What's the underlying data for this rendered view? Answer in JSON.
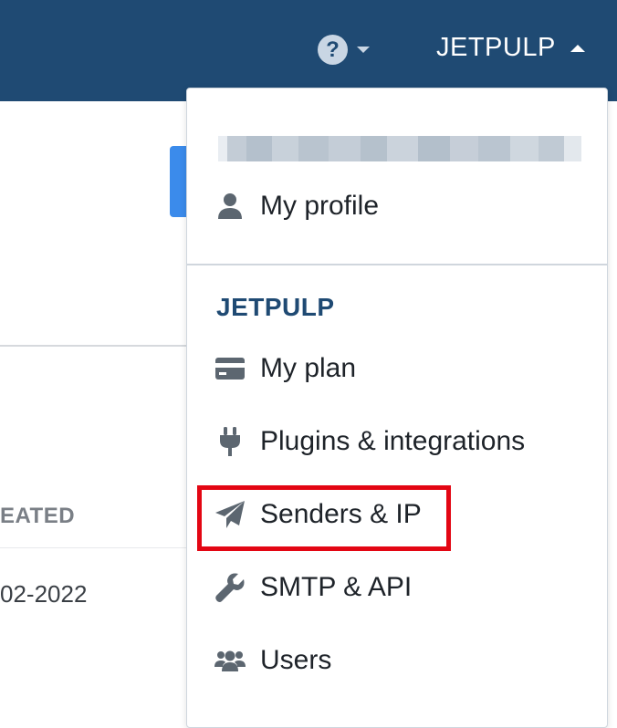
{
  "header": {
    "help_glyph": "?",
    "account_name": "JETPULP"
  },
  "background": {
    "column_header": "EATED",
    "cell_value": "02-2022"
  },
  "dropdown": {
    "section_title": "JETPULP",
    "items": [
      {
        "label": "My profile",
        "icon": "user-icon"
      },
      {
        "label": "My plan",
        "icon": "credit-card-icon"
      },
      {
        "label": "Plugins & integrations",
        "icon": "plug-icon"
      },
      {
        "label": "Senders & IP",
        "icon": "paper-plane-icon"
      },
      {
        "label": "SMTP & API",
        "icon": "wrench-icon"
      },
      {
        "label": "Users",
        "icon": "users-icon"
      }
    ]
  },
  "colors": {
    "header_bg": "#1f4a73",
    "highlight": "#e30613",
    "icon": "#5c6670"
  }
}
